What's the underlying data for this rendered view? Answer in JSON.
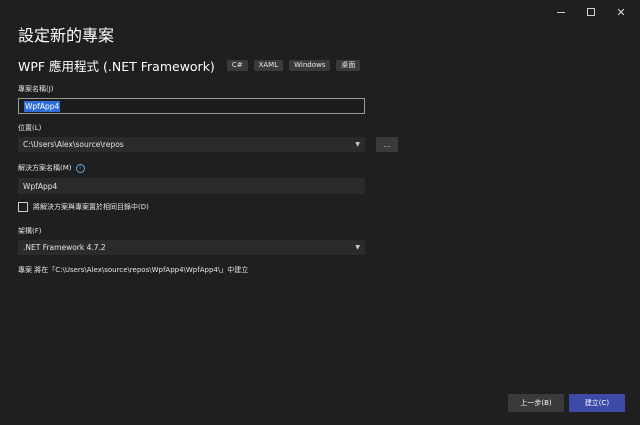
{
  "window": {
    "controls": {
      "close": "✕"
    }
  },
  "page_title": "設定新的專案",
  "template": {
    "name": "WPF 應用程式 (.NET Framework)",
    "tags": [
      "C#",
      "XAML",
      "Windows",
      "桌面"
    ]
  },
  "project_name": {
    "label": "專案名稱(J)",
    "value": "WpfApp4"
  },
  "location": {
    "label": "位置(L)",
    "value": "C:\\Users\\Alex\\source\\repos",
    "browse_label": "..."
  },
  "solution_name": {
    "label": "解決方案名稱(M)",
    "info_icon": "i",
    "value": "WpfApp4"
  },
  "same_directory": {
    "label": "將解決方案與專案置於相同目錄中(D)",
    "checked": false
  },
  "framework": {
    "label": "架構(F)",
    "value": ".NET Framework 4.7.2"
  },
  "summary_text": "專案 將在「C:\\Users\\Alex\\source\\repos\\WpfApp4\\WpfApp4\\」中建立",
  "buttons": {
    "back": "上一步(B)",
    "create": "建立(C)"
  },
  "colors": {
    "background": "#1f1f1f",
    "input": "#2b2b2b",
    "accent": "#3d4aa8",
    "selection": "#2f6ed8"
  }
}
